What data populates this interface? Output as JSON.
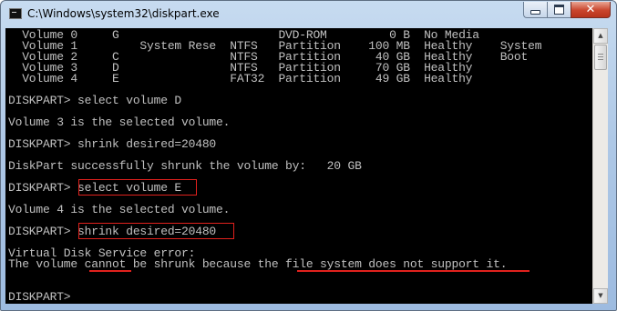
{
  "window": {
    "title": "C:\\Windows\\system32\\diskpart.exe",
    "accent_close": "#c9442c",
    "console_bg": "#000000",
    "console_fg": "#c0c0c0",
    "highlight_color": "#e0211d"
  },
  "icons": {
    "app": "console-icon",
    "minimize": "minimize-icon",
    "maximize": "maximize-icon",
    "close": "close-icon",
    "scroll_up": "arrow-up-icon",
    "scroll_down": "arrow-down-icon"
  },
  "console": {
    "lines": [
      "  Volume 0     G                       DVD-ROM         0 B  No Media",
      "  Volume 1         System Rese  NTFS   Partition    100 MB  Healthy    System",
      "  Volume 2     C                NTFS   Partition     40 GB  Healthy    Boot",
      "  Volume 3     D                NTFS   Partition     70 GB  Healthy",
      "  Volume 4     E                FAT32  Partition     49 GB  Healthy",
      "",
      "DISKPART> select volume D",
      "",
      "Volume 3 is the selected volume.",
      "",
      "DISKPART> shrink desired=20480",
      "",
      "DiskPart successfully shrunk the volume by:   20 GB",
      "",
      "DISKPART> select volume E",
      "",
      "Volume 4 is the selected volume.",
      "",
      "DISKPART> shrink desired=20480",
      "",
      "Virtual Disk Service error:",
      "The volume cannot be shrunk because the file system does not support it.",
      "",
      "",
      "DISKPART> "
    ],
    "highlighted_commands": [
      "select volume E",
      "shrink desired=20480"
    ],
    "underlined_phrases": [
      "cannot",
      "file system does not support it"
    ]
  }
}
